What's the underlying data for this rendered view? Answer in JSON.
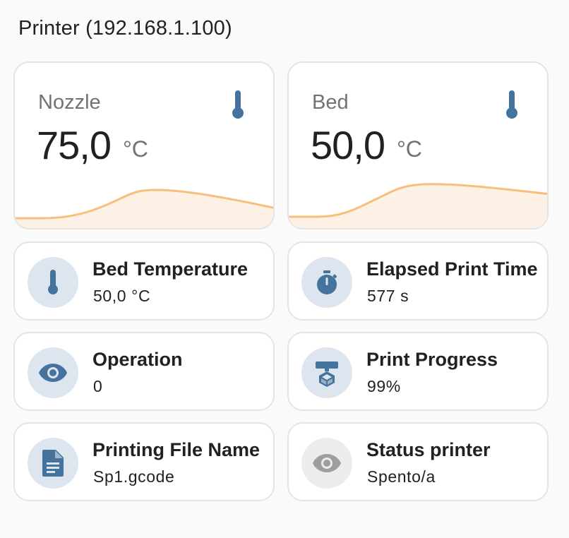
{
  "header": {
    "title": "Printer (192.168.1.100)"
  },
  "colors": {
    "accent": "#44739e",
    "graph_line": "#f7bf7d",
    "graph_fill": "#fdf1e6",
    "icon_off": "#9e9e9e"
  },
  "sensors": [
    {
      "name": "Nozzle",
      "value": "75,0",
      "unit": "°C",
      "icon": "thermometer-icon"
    },
    {
      "name": "Bed",
      "value": "50,0",
      "unit": "°C",
      "icon": "thermometer-icon"
    }
  ],
  "tiles": [
    {
      "label": "Bed Temperature",
      "state": "50,0 °C",
      "icon": "thermometer-icon"
    },
    {
      "label": "Elapsed Print Time",
      "state": "577 s",
      "icon": "timer-icon"
    },
    {
      "label": "Operation",
      "state": "0",
      "icon": "eye-icon"
    },
    {
      "label": "Print Progress",
      "state": "99%",
      "icon": "printer-3d-icon"
    },
    {
      "label": "Printing File Name",
      "state": "Sp1.gcode",
      "icon": "file-document-icon"
    },
    {
      "label": "Status printer",
      "state": "Spento/a",
      "icon": "eye-icon"
    }
  ]
}
